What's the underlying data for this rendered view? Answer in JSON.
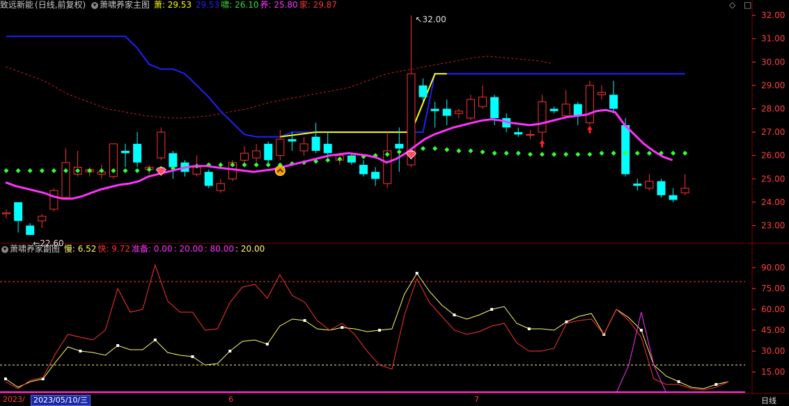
{
  "main_header": {
    "stock": "致远新能",
    "mode": "(日线,前复权)",
    "indicator": "萧啸养家主图",
    "items": [
      {
        "label": "萧:",
        "value": "29.53",
        "color": "#ffff00"
      },
      {
        "label": "",
        "value": "29.53",
        "color": "#2020ff"
      },
      {
        "label": "啸:",
        "value": "26.10",
        "color": "#33dd33"
      },
      {
        "label": "养:",
        "value": "25.80",
        "color": "#ff33ff"
      },
      {
        "label": "家:",
        "value": "29.87",
        "color": "#ff3333"
      }
    ]
  },
  "sub_header": {
    "indicator": "萧啸养家副图",
    "items": [
      {
        "label": "慢:",
        "value": "6.52",
        "color": "#ffff66"
      },
      {
        "label": "快:",
        "value": "9.72",
        "color": "#ff3333"
      },
      {
        "label": "准备:",
        "value": "0.00",
        "color": "#ff33ff"
      },
      {
        "label": ":",
        "value": "20.00",
        "color": "#ff33ff"
      },
      {
        "label": ":",
        "value": "80.00",
        "color": "#ff33ff"
      },
      {
        "label": ":",
        "value": "20.00",
        "color": "#ffff66"
      }
    ]
  },
  "corner_icons": {
    "diamond": "◇",
    "square": "□"
  },
  "bottom": {
    "date_prefix": "2023/",
    "selected_date": "2023/05/10/三",
    "month_ticks": [
      "6",
      "7"
    ],
    "period": "日线"
  },
  "colors": {
    "up": "#ff3232",
    "down": "#00ffff",
    "magenta": "#ff33ff",
    "blue": "#2020ff",
    "yellow": "#ffff00",
    "green_dot": "#33ff33",
    "grid": "#800000",
    "axis_text": "#ff4040"
  },
  "chart_data": [
    {
      "type": "candlestick",
      "name": "main",
      "y_range": [
        22.3,
        32.3
      ],
      "y_ticks": [
        23,
        24,
        25,
        26,
        27,
        28,
        29,
        30,
        31,
        32
      ],
      "y_tick_labels": [
        "23.00",
        "24.00",
        "25.00",
        "26.00",
        "27.00",
        "28.00",
        "29.00",
        "30.00",
        "31.00",
        "32.00"
      ],
      "annotations": [
        {
          "text": "32.00",
          "index": 34,
          "value": 32.0
        },
        {
          "text": "←22.60",
          "index": 2,
          "value": 22.6
        }
      ],
      "candles": [
        [
          23.5,
          23.55,
          23.7,
          23.3
        ],
        [
          24.0,
          23.2,
          24.0,
          22.7
        ],
        [
          23.0,
          22.6,
          23.1,
          22.6
        ],
        [
          23.2,
          23.4,
          23.5,
          22.9
        ],
        [
          23.7,
          24.5,
          24.6,
          23.6
        ],
        [
          24.2,
          25.7,
          26.3,
          24.1
        ],
        [
          25.2,
          25.5,
          26.2,
          25.1
        ],
        [
          25.3,
          25.4,
          25.5,
          25.1
        ],
        [
          25.2,
          25.3,
          25.6,
          25.0
        ],
        [
          25.1,
          26.5,
          26.5,
          25.0
        ],
        [
          26.2,
          26.1,
          26.5,
          25.5
        ],
        [
          26.5,
          25.7,
          27.0,
          25.5
        ],
        [
          25.4,
          25.5,
          25.6,
          25.2
        ],
        [
          25.9,
          27.0,
          27.2,
          25.8
        ],
        [
          26.1,
          25.5,
          26.2,
          25.0
        ],
        [
          25.7,
          25.3,
          25.8,
          25.1
        ],
        [
          25.2,
          25.5,
          26.0,
          25.1
        ],
        [
          25.3,
          24.7,
          25.4,
          24.6
        ],
        [
          24.5,
          24.8,
          25.0,
          24.4
        ],
        [
          25.0,
          25.7,
          25.8,
          24.9
        ],
        [
          25.8,
          26.1,
          26.4,
          25.5
        ],
        [
          25.9,
          26.2,
          26.5,
          25.7
        ],
        [
          26.5,
          25.8,
          26.6,
          25.5
        ],
        [
          26.0,
          26.7,
          27.1,
          25.8
        ],
        [
          26.7,
          26.6,
          27.0,
          26.2
        ],
        [
          26.2,
          26.5,
          26.8,
          26.0
        ],
        [
          26.8,
          26.2,
          27.4,
          26.1
        ],
        [
          26.5,
          26.1,
          27.0,
          25.9
        ],
        [
          25.8,
          26.0,
          26.1,
          25.6
        ],
        [
          26.0,
          25.7,
          26.1,
          25.6
        ],
        [
          25.6,
          25.2,
          25.8,
          25.1
        ],
        [
          25.3,
          25.0,
          25.5,
          24.7
        ],
        [
          24.8,
          26.2,
          27.0,
          24.6
        ],
        [
          26.5,
          26.3,
          27.2,
          25.3
        ],
        [
          25.6,
          29.5,
          32.0,
          25.5
        ],
        [
          29.0,
          28.5,
          29.3,
          28.3
        ],
        [
          28.0,
          27.9,
          28.3,
          27.2
        ],
        [
          28.0,
          27.7,
          28.4,
          27.3
        ],
        [
          27.8,
          27.9,
          28.0,
          27.6
        ],
        [
          27.6,
          28.4,
          28.6,
          27.5
        ],
        [
          28.1,
          28.5,
          29.0,
          28.0
        ],
        [
          28.5,
          27.6,
          28.6,
          27.3
        ],
        [
          27.6,
          27.2,
          27.8,
          27.0
        ],
        [
          27.0,
          26.9,
          27.2,
          26.8
        ],
        [
          26.9,
          26.9,
          27.1,
          26.7
        ],
        [
          27.0,
          28.3,
          28.6,
          26.6
        ],
        [
          28.0,
          27.9,
          28.1,
          27.8
        ],
        [
          27.7,
          28.2,
          28.8,
          27.6
        ],
        [
          28.2,
          27.7,
          28.3,
          27.3
        ],
        [
          27.4,
          29.0,
          29.2,
          27.3
        ],
        [
          28.6,
          28.7,
          29.0,
          28.4
        ],
        [
          28.6,
          28.0,
          29.2,
          27.8
        ],
        [
          27.3,
          25.2,
          27.6,
          25.1
        ],
        [
          24.8,
          24.7,
          25.0,
          24.5
        ],
        [
          24.6,
          24.9,
          25.2,
          24.5
        ],
        [
          24.9,
          24.3,
          25.0,
          24.2
        ],
        [
          24.3,
          24.1,
          24.6,
          24.0
        ],
        [
          24.4,
          24.6,
          25.2,
          24.3
        ]
      ],
      "pink_line": [
        24.85,
        24.7,
        24.6,
        24.5,
        24.4,
        24.25,
        24.15,
        24.15,
        24.25,
        24.4,
        24.55,
        24.65,
        24.75,
        24.8,
        24.9,
        25.1,
        25.2,
        25.3,
        25.4,
        25.5,
        25.55,
        25.55,
        25.5,
        25.45,
        25.4,
        25.35,
        25.3,
        25.35,
        25.4,
        25.5,
        25.6,
        25.7,
        25.8,
        25.9,
        26.0,
        26.05,
        26.1,
        26.05,
        26.0,
        25.9,
        25.7,
        25.85,
        26.1,
        26.4,
        26.7,
        26.9,
        27.05,
        27.2,
        27.3,
        27.4,
        27.5,
        27.55,
        27.5,
        27.4,
        27.35,
        27.3,
        27.35,
        27.45,
        27.55,
        27.65,
        27.7,
        27.75,
        27.9,
        27.95,
        27.85,
        27.3,
        26.9,
        26.5,
        26.2,
        25.95,
        25.8
      ],
      "pink_x_step": 0.8,
      "red_dashed": [
        29.8,
        29.6,
        29.4,
        29.2,
        28.9,
        28.6,
        28.4,
        28.2,
        28.0,
        27.9,
        27.8,
        27.7,
        27.65,
        27.6,
        27.6,
        27.65,
        27.7,
        27.8,
        27.9,
        28.0,
        28.15,
        28.3,
        28.4,
        28.5,
        28.6,
        28.7,
        28.8,
        28.9,
        29.1,
        29.3,
        29.5,
        29.6,
        29.7,
        29.8,
        29.9,
        30.0,
        30.1,
        30.2,
        30.25,
        30.2,
        30.15,
        30.1,
        30.05,
        29.95
      ],
      "red_dashed_x_step": 1.35,
      "blue_line": [
        31.1,
        31.1,
        31.1,
        31.1,
        31.1,
        31.1,
        31.1,
        31.1,
        31.1,
        31.1,
        31.1,
        30.6,
        29.9,
        29.7,
        29.7,
        29.5,
        29.0,
        28.5,
        27.9,
        27.4,
        26.9,
        26.8,
        26.8,
        26.8,
        27.0,
        27.0,
        27.0,
        27.0,
        27.0,
        27.0,
        27.0,
        27.0,
        27.0,
        27.0,
        27.0,
        27.0,
        29.5,
        29.5,
        29.5,
        29.5,
        29.5,
        29.5,
        29.5,
        29.5,
        29.5,
        29.5,
        29.5,
        29.5,
        29.5,
        29.5,
        29.5,
        29.5,
        29.5,
        29.5,
        29.5,
        29.5,
        29.5,
        29.5
      ],
      "yellow_line": [
        [
          23,
          26.8
        ],
        [
          26,
          27.0
        ],
        [
          34,
          27.0
        ],
        [
          36,
          29.5
        ],
        [
          37,
          29.5
        ]
      ],
      "green_dots": [
        [
          0,
          25.35
        ],
        [
          1,
          25.35
        ],
        [
          2,
          25.35
        ],
        [
          3,
          25.35
        ],
        [
          4,
          25.35
        ],
        [
          5,
          25.35
        ],
        [
          6,
          25.35
        ],
        [
          7,
          25.35
        ],
        [
          8,
          25.35
        ],
        [
          9,
          25.35
        ],
        [
          10,
          25.35
        ],
        [
          11,
          25.35
        ],
        [
          12,
          25.4
        ],
        [
          13,
          25.45
        ],
        [
          14,
          25.45
        ],
        [
          15,
          25.5
        ],
        [
          16,
          25.55
        ],
        [
          17,
          25.6
        ],
        [
          18,
          25.6
        ],
        [
          19,
          25.6
        ],
        [
          20,
          25.6
        ],
        [
          21,
          25.6
        ],
        [
          22,
          25.6
        ],
        [
          23,
          25.6
        ],
        [
          24,
          25.65
        ],
        [
          25,
          25.7
        ],
        [
          26,
          25.75
        ],
        [
          27,
          25.8
        ],
        [
          28,
          25.85
        ],
        [
          29,
          25.9
        ],
        [
          30,
          25.95
        ],
        [
          31,
          26.0
        ],
        [
          32,
          26.05
        ],
        [
          33,
          26.15
        ],
        [
          34,
          26.2
        ],
        [
          35,
          26.3
        ],
        [
          36,
          26.3
        ],
        [
          37,
          26.25
        ],
        [
          38,
          26.2
        ],
        [
          39,
          26.2
        ],
        [
          40,
          26.15
        ],
        [
          41,
          26.1
        ],
        [
          42,
          26.1
        ],
        [
          43,
          26.1
        ],
        [
          44,
          26.05
        ],
        [
          45,
          26.05
        ],
        [
          46,
          26.05
        ],
        [
          47,
          26.05
        ],
        [
          48,
          26.05
        ],
        [
          49,
          26.05
        ],
        [
          50,
          26.1
        ],
        [
          51,
          26.1
        ],
        [
          52,
          26.1
        ],
        [
          53,
          26.1
        ],
        [
          54,
          26.1
        ],
        [
          55,
          26.1
        ],
        [
          56,
          26.1
        ],
        [
          57,
          26.1
        ]
      ],
      "signals": [
        {
          "type": "gem",
          "index": 13,
          "value": 25.3
        },
        {
          "type": "gem",
          "index": 34,
          "value": 26.0
        },
        {
          "type": "coin",
          "index": 23,
          "value": 25.35
        },
        {
          "type": "up-arrow",
          "index": 45,
          "value": 26.5
        },
        {
          "type": "up-arrow",
          "index": 49,
          "value": 27.1
        }
      ]
    },
    {
      "type": "line",
      "name": "sub",
      "y_range": [
        0,
        100
      ],
      "y_ticks": [
        15,
        30,
        45,
        60,
        75,
        90
      ],
      "y_tick_labels": [
        "15.00",
        "30.00",
        "45.00",
        "60.00",
        "75.00",
        "90.00"
      ],
      "ref_lines": [
        {
          "value": 80,
          "color": "#ff3333"
        },
        {
          "value": 20,
          "color": "#ffff66"
        }
      ],
      "series": [
        {
          "name": "慢",
          "color": "#ffff66",
          "values": [
            10,
            4,
            8,
            10,
            22,
            33,
            30,
            29,
            27,
            34,
            31,
            31,
            38,
            29,
            27,
            26,
            20,
            21,
            30,
            37,
            38,
            35,
            48,
            53,
            52,
            46,
            45,
            47,
            46,
            44,
            45,
            46,
            71,
            86,
            73,
            63,
            56,
            53,
            56,
            60,
            62,
            50,
            46,
            46,
            45,
            51,
            55,
            57,
            42,
            60,
            54,
            45,
            20,
            12,
            8,
            4,
            3,
            6,
            8
          ]
        },
        {
          "name": "快",
          "color": "#ff3333",
          "values": [
            8,
            3,
            9,
            11,
            28,
            42,
            40,
            38,
            45,
            75,
            58,
            60,
            92,
            66,
            58,
            58,
            45,
            46,
            65,
            76,
            78,
            68,
            85,
            70,
            65,
            52,
            45,
            50,
            42,
            30,
            20,
            17,
            56,
            82,
            65,
            55,
            45,
            42,
            44,
            48,
            50,
            36,
            30,
            30,
            32,
            50,
            52,
            53,
            42,
            60,
            52,
            40,
            10,
            6,
            6,
            3,
            2,
            4,
            8
          ]
        },
        {
          "name": "准备",
          "color": "#ff33ff",
          "values": [
            0,
            0,
            0,
            0,
            0,
            0,
            0,
            0,
            0,
            0,
            0,
            0,
            0,
            0,
            0,
            0,
            0,
            0,
            0,
            0,
            0,
            0,
            0,
            0,
            0,
            0,
            0,
            0,
            0,
            0,
            0,
            0,
            0,
            0,
            0,
            0,
            0,
            0,
            0,
            0,
            0,
            0,
            0,
            0,
            0,
            0,
            0,
            0,
            0,
            0,
            20,
            58,
            20,
            0,
            0,
            0,
            0,
            0,
            0
          ]
        }
      ]
    }
  ]
}
